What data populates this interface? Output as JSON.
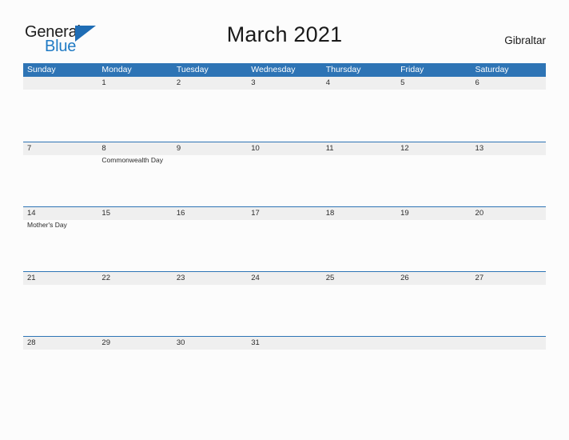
{
  "brand": {
    "name_part1": "General",
    "name_part2": "Blue",
    "triangle_icon": "blue-triangle-icon",
    "colors": {
      "dark_text": "#1c1c1c",
      "blue_text": "#1f7ac4",
      "triangle": "#1f6db5"
    }
  },
  "header": {
    "title": "March 2021",
    "location": "Gibraltar"
  },
  "calendar": {
    "month": "March",
    "year": "2021",
    "header_color": "#2e74b5",
    "band_color": "#efefef",
    "weekdays": [
      "Sunday",
      "Monday",
      "Tuesday",
      "Wednesday",
      "Thursday",
      "Friday",
      "Saturday"
    ],
    "weeks": [
      {
        "days": [
          {
            "number": "",
            "events": []
          },
          {
            "number": "1",
            "events": []
          },
          {
            "number": "2",
            "events": []
          },
          {
            "number": "3",
            "events": []
          },
          {
            "number": "4",
            "events": []
          },
          {
            "number": "5",
            "events": []
          },
          {
            "number": "6",
            "events": []
          }
        ]
      },
      {
        "days": [
          {
            "number": "7",
            "events": []
          },
          {
            "number": "8",
            "events": [
              "Commonwealth Day"
            ]
          },
          {
            "number": "9",
            "events": []
          },
          {
            "number": "10",
            "events": []
          },
          {
            "number": "11",
            "events": []
          },
          {
            "number": "12",
            "events": []
          },
          {
            "number": "13",
            "events": []
          }
        ]
      },
      {
        "days": [
          {
            "number": "14",
            "events": [
              "Mother's Day"
            ]
          },
          {
            "number": "15",
            "events": []
          },
          {
            "number": "16",
            "events": []
          },
          {
            "number": "17",
            "events": []
          },
          {
            "number": "18",
            "events": []
          },
          {
            "number": "19",
            "events": []
          },
          {
            "number": "20",
            "events": []
          }
        ]
      },
      {
        "days": [
          {
            "number": "21",
            "events": []
          },
          {
            "number": "22",
            "events": []
          },
          {
            "number": "23",
            "events": []
          },
          {
            "number": "24",
            "events": []
          },
          {
            "number": "25",
            "events": []
          },
          {
            "number": "26",
            "events": []
          },
          {
            "number": "27",
            "events": []
          }
        ]
      },
      {
        "days": [
          {
            "number": "28",
            "events": []
          },
          {
            "number": "29",
            "events": []
          },
          {
            "number": "30",
            "events": []
          },
          {
            "number": "31",
            "events": []
          },
          {
            "number": "",
            "events": []
          },
          {
            "number": "",
            "events": []
          },
          {
            "number": "",
            "events": []
          }
        ]
      }
    ]
  }
}
